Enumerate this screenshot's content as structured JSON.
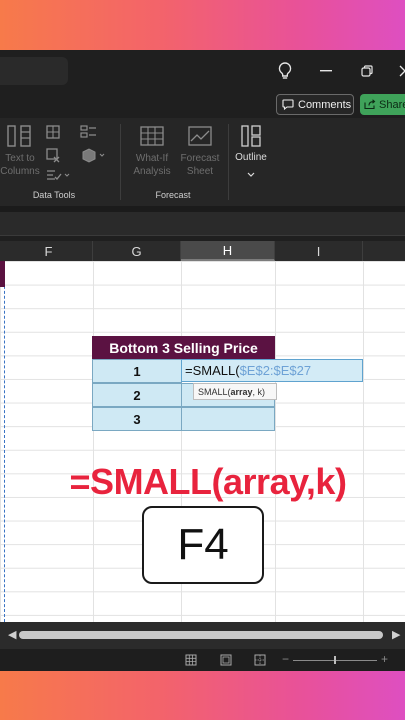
{
  "toolbar": {
    "comments_label": "Comments",
    "share_label": "Share",
    "icons": [
      "lightbulb-icon",
      "minimize-icon",
      "restore-icon",
      "close-icon"
    ]
  },
  "ribbon": {
    "text_to_columns_line1": "Text to",
    "text_to_columns_line2": "Columns",
    "data_tools_label": "Data Tools",
    "what_if_line1": "What-If",
    "what_if_line2": "Analysis",
    "forecast_sheet_line1": "Forecast",
    "forecast_sheet_line2": "Sheet",
    "forecast_group_label": "Forecast",
    "outline_label": "Outline"
  },
  "columns": [
    "F",
    "G",
    "H",
    "I"
  ],
  "active_column": "H",
  "table": {
    "header": "Bottom 3 Selling Price",
    "rows": [
      "1",
      "2",
      "3"
    ]
  },
  "editing": {
    "formula_prefix": "=SMALL(",
    "formula_ref": "$E$2:$E$27",
    "tooltip_fn": "SMALL(",
    "tooltip_arg1": "array",
    "tooltip_rest": ", k)"
  },
  "overlay": {
    "formula_text": "=SMALL(array,k)",
    "key_label": "F4"
  },
  "colors": {
    "table_header_bg": "#5b1242",
    "table_cell_bg": "#cfe9f4",
    "overlay_red": "#e8233d",
    "share_green": "#3fa35a"
  }
}
